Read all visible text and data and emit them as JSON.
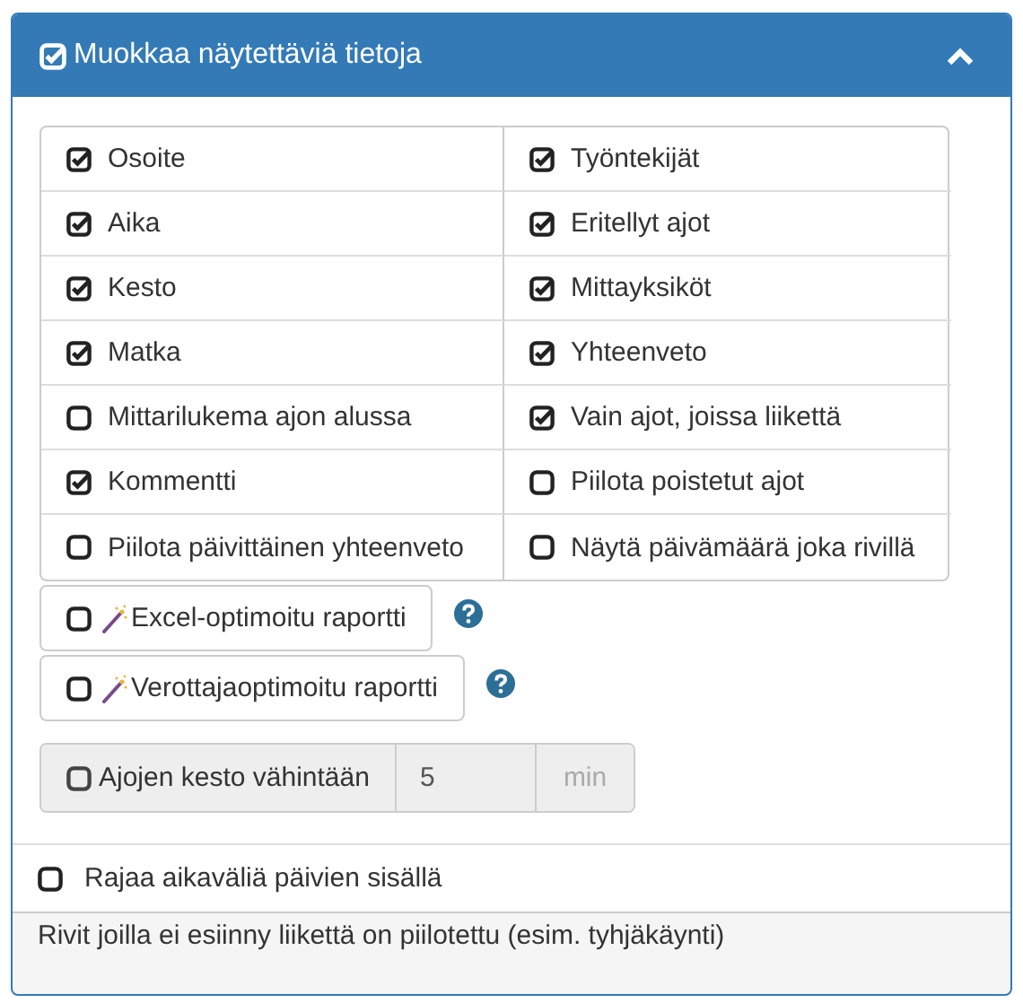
{
  "panel": {
    "title": "Muokkaa näytettäviä tietoja",
    "expanded": true
  },
  "options": [
    {
      "label": "Osoite",
      "checked": true
    },
    {
      "label": "Työntekijät",
      "checked": true
    },
    {
      "label": "Aika",
      "checked": true
    },
    {
      "label": "Eritellyt ajot",
      "checked": true
    },
    {
      "label": "Kesto",
      "checked": true
    },
    {
      "label": "Mittayksiköt",
      "checked": true
    },
    {
      "label": "Matka",
      "checked": true
    },
    {
      "label": "Yhteenveto",
      "checked": true
    },
    {
      "label": "Mittarilukema ajon alussa",
      "checked": false
    },
    {
      "label": "Vain ajot, joissa liikettä",
      "checked": true
    },
    {
      "label": "Kommentti",
      "checked": true
    },
    {
      "label": "Piilota poistetut ajot",
      "checked": false
    },
    {
      "label": "Piilota päivittäinen yhteenveto",
      "checked": false
    },
    {
      "label": "Näytä päivämäärä joka rivillä",
      "checked": false
    }
  ],
  "reports": [
    {
      "label": "Excel-optimoitu raportti",
      "checked": false
    },
    {
      "label": "Verottajaoptimoitu raportti",
      "checked": false
    }
  ],
  "min_duration": {
    "label": "Ajojen kesto vähintään",
    "checked": false,
    "disabled": true,
    "value": "5",
    "unit": "min"
  },
  "range": {
    "label": "Rajaa aikaväliä päivien sisällä",
    "checked": false
  },
  "note": "Rivit joilla ei esiinny liikettä on piilotettu (esim. tyhjäkäynti)"
}
